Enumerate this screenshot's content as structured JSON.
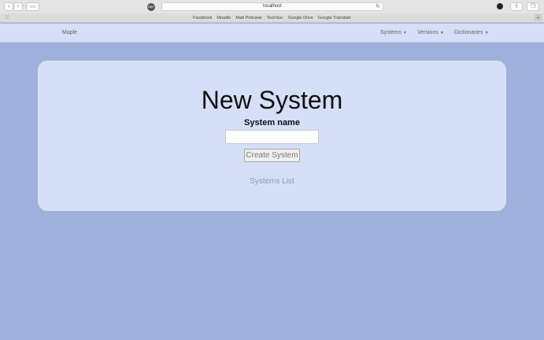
{
  "browser": {
    "address": "localhost",
    "favorites": [
      "Facebook",
      "Moodle",
      "Matt Policane",
      "TechSoc",
      "Google Drive",
      "Google Translate"
    ]
  },
  "nav": {
    "brand": "Maple",
    "items": [
      {
        "label": "Systems"
      },
      {
        "label": "Versions"
      },
      {
        "label": "Dictionaries"
      }
    ]
  },
  "form": {
    "title": "New System",
    "field_label": "System name",
    "field_value": "",
    "submit_label": "Create System",
    "back_link": "Systems List"
  },
  "colors": {
    "background": "#9fb0da",
    "panel": "#d5dff7",
    "link": "#8898c7"
  }
}
